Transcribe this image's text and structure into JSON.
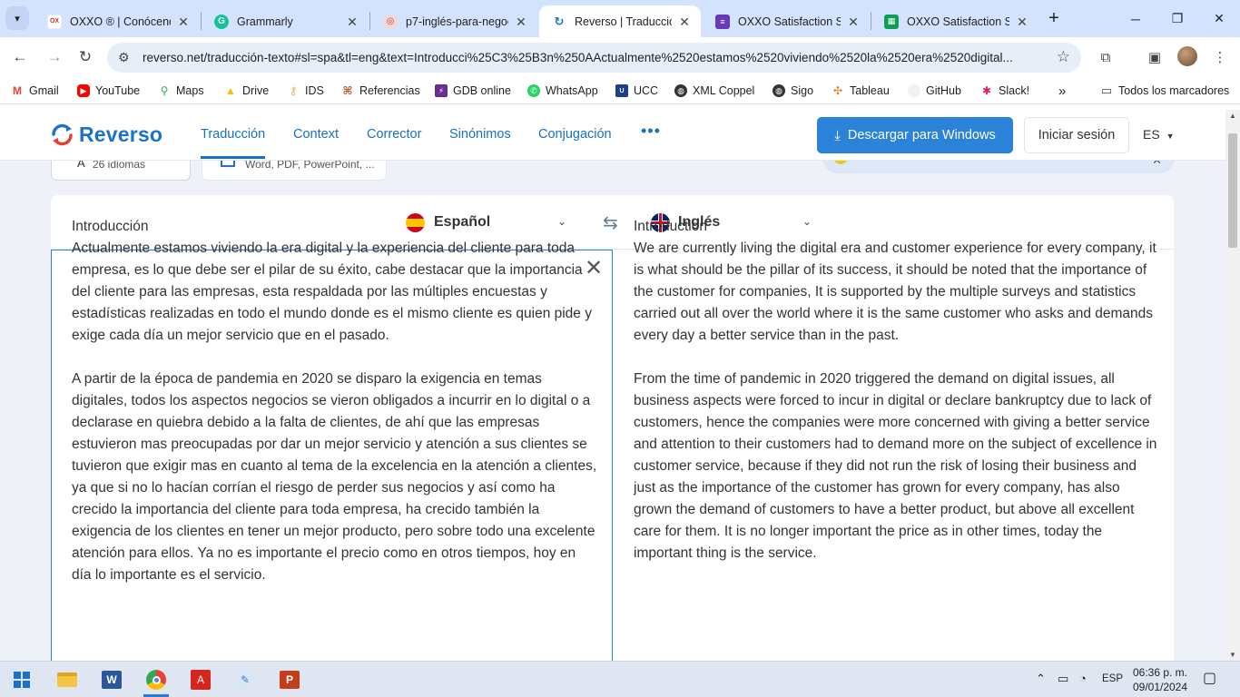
{
  "browser": {
    "tabs": [
      {
        "label": "OXXO ® | Conócenos",
        "icon": "oxxo-icon",
        "color": "#d52b1e"
      },
      {
        "label": "Grammarly",
        "icon": "grammarly-icon",
        "color": "#15c39a"
      },
      {
        "label": "p7-inglés-para-negoc",
        "icon": "file-icon",
        "color": "#c66"
      },
      {
        "label": "Reverso | Traducción",
        "icon": "reverso-icon",
        "color": "#1a73c9",
        "active": true
      },
      {
        "label": "OXXO Satisfaction Su",
        "icon": "forms-icon",
        "color": "#673ab7"
      },
      {
        "label": "OXXO Satisfaction Su",
        "icon": "sheets-icon",
        "color": "#0f9d58"
      }
    ],
    "url": "reverso.net/traducción-texto#sl=spa&tl=eng&text=Introducci%25C3%25B3n%250AActualmente%2520estamos%2520viviendo%2520la%2520era%2520digital...",
    "bookmarks": [
      {
        "label": "Gmail",
        "icon": "gmail-icon",
        "color": "#ea4335"
      },
      {
        "label": "YouTube",
        "icon": "youtube-icon",
        "color": "#ff0000"
      },
      {
        "label": "Maps",
        "icon": "maps-icon",
        "color": "#34a853"
      },
      {
        "label": "Drive",
        "icon": "drive-icon",
        "color": "#fbbc04"
      },
      {
        "label": "IDS",
        "icon": "ids-icon",
        "color": "#e3b341"
      },
      {
        "label": "Referencias",
        "icon": "referencias-icon",
        "color": "#c0502a"
      },
      {
        "label": "GDB online",
        "icon": "gdb-icon",
        "color": "#6a2c91"
      },
      {
        "label": "WhatsApp",
        "icon": "whatsapp-icon",
        "color": "#25d366"
      },
      {
        "label": "UCC",
        "icon": "ucc-icon",
        "color": "#1c3f94"
      },
      {
        "label": "XML Coppel",
        "icon": "globe-icon",
        "color": "#333333"
      },
      {
        "label": "Sigo",
        "icon": "globe-icon",
        "color": "#333333"
      },
      {
        "label": "Tableau",
        "icon": "tableau-icon",
        "color": "#e97627"
      },
      {
        "label": "GitHub",
        "icon": "github-icon",
        "color": "#cccccc"
      },
      {
        "label": "Slack!",
        "icon": "slack-icon",
        "color": "#e01e5a"
      }
    ],
    "bookmarks_more": "»",
    "all_bookmarks": "Todos los marcadores"
  },
  "site": {
    "logo": "Reverso",
    "nav": [
      "Traducción",
      "Context",
      "Corrector",
      "Sinónimos",
      "Conjugación"
    ],
    "more": "•••",
    "download_btn": "Descargar para Windows",
    "login_btn": "Iniciar sesión",
    "ui_lang": "ES",
    "mode_card_1_sub": "26 idiomas",
    "mode_card_2_sub": "Word, PDF, PowerPoint, ..."
  },
  "translator": {
    "source_lang": "Español",
    "target_lang": "Inglés",
    "source_text": "Introducción\nActualmente estamos viviendo la era digital y la experiencia del cliente para toda empresa, es lo que debe ser el pilar de su éxito, cabe destacar que la importancia del cliente para las empresas, esta respaldada por las múltiples encuestas y estadísticas realizadas en todo el mundo donde es el mismo cliente es quien pide y exige cada día un mejor servicio que en el pasado.\n\nA partir de la época de pandemia en 2020 se disparo la exigencia en temas digitales, todos los aspectos negocios se vieron obligados a incurrir en lo digital o a declarase en quiebra debido a la falta de clientes, de ahí que las empresas estuvieron mas preocupadas por dar un mejor servicio y atención a sus clientes se tuvieron que exigir mas en cuanto al tema de la excelencia en la atención a clientes, ya que si no lo hacían corrían el riesgo de perder sus negocios y así como ha crecido la importancia del cliente para toda empresa, ha crecido también la exigencia de los clientes en tener un mejor producto, pero sobre todo una excelente atención para ellos. Ya no es importante el precio como en otros tiempos, hoy en día lo importante es el servicio.",
    "target_text": "        Introduction\nWe are currently living the digital era and customer experience for every company, it is what should be the pillar of its success, it should be noted that the importance of the customer for companies, It is supported by the multiple surveys and statistics carried out all over the world where it is the same customer who asks and demands every day a better service than in the past.\n\nFrom the time of pandemic in 2020 triggered the demand on digital issues, all business aspects were forced to incur in digital or declare bankruptcy due to lack of customers, hence the companies were more concerned with giving a better service and attention to their customers had to demand more on the subject of excellence in customer service, because if they did not run the risk of losing their business and just as the importance of the customer has grown for every company, has also grown the demand of customers to have a better product, but above all excellent care for them. It is no longer important the price as in other times, today the important thing is the service."
  },
  "taskbar": {
    "lang": "ESP",
    "time": "06:36 p. m.",
    "date": "09/01/2024"
  }
}
